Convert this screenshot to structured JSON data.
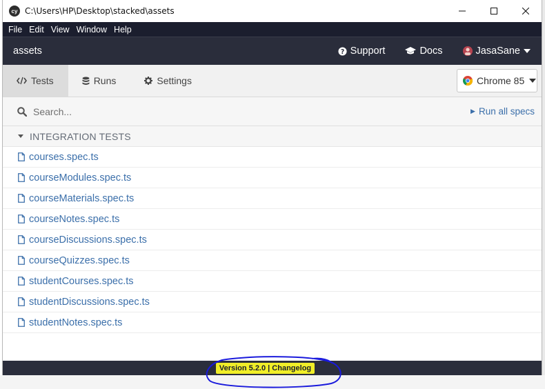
{
  "window": {
    "title": "C:\\Users\\HP\\Desktop\\stacked\\assets",
    "logo_text": "cy"
  },
  "menu": [
    "File",
    "Edit",
    "View",
    "Window",
    "Help"
  ],
  "header": {
    "project": "assets",
    "support": "Support",
    "docs": "Docs",
    "user": "JasaSane"
  },
  "tabs": [
    {
      "label": "Tests",
      "icon": "code-icon",
      "active": true
    },
    {
      "label": "Runs",
      "icon": "database-icon",
      "active": false
    },
    {
      "label": "Settings",
      "icon": "gear-icon",
      "active": false
    }
  ],
  "browser": {
    "label": "Chrome 85"
  },
  "search": {
    "placeholder": "Search...",
    "run_all": "Run all specs"
  },
  "folder": {
    "label": "INTEGRATION TESTS"
  },
  "specs": [
    "courses.spec.ts",
    "courseModules.spec.ts",
    "courseMaterials.spec.ts",
    "courseNotes.spec.ts",
    "courseDiscussions.spec.ts",
    "courseQuizzes.spec.ts",
    "studentCourses.spec.ts",
    "studentDiscussions.spec.ts",
    "studentNotes.spec.ts"
  ],
  "footer": {
    "text": "Version 5.2.0 | Changelog"
  },
  "colors": {
    "link": "#3b6faa",
    "header_bg": "#2a2d3b",
    "menu_bg": "#1b1e2e",
    "highlight": "#f0ee28",
    "annotation": "#1a1adc"
  }
}
